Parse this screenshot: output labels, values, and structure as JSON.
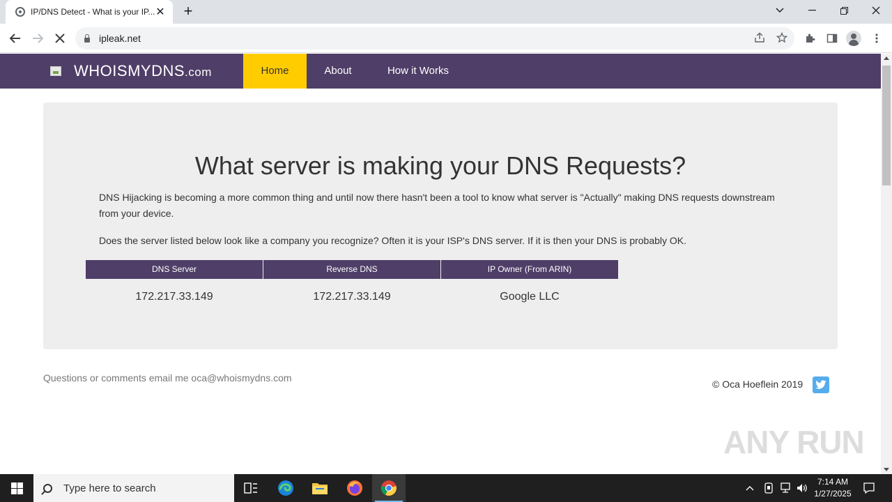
{
  "browser": {
    "tab_title": "IP/DNS Detect - What is your IP...",
    "url": "ipleak.net"
  },
  "site": {
    "brand_prefix": "WHOIS",
    "brand_main": "MYDNS",
    "brand_suffix": ".com",
    "nav": {
      "home": "Home",
      "about": "About",
      "how_it_works": "How it Works"
    },
    "heading": "What server is making your DNS Requests?",
    "para1": "DNS Hijacking is becoming a more common thing and until now there hasn't been a tool to know what server is \"Actually\" making DNS requests downstream from your device.",
    "para2": "Does the server listed below look like a company you recognize? Often it is your ISP's DNS server. If it is then your DNS is probably OK.",
    "table": {
      "headers": [
        "DNS Server",
        "Reverse DNS",
        "IP Owner (From ARIN)"
      ],
      "row": [
        "172.217.33.149",
        "172.217.33.149",
        "Google LLC"
      ]
    },
    "footer_contact": "Questions or comments email me oca@whoismydns.com",
    "footer_copyright": "© Oca Hoeflein 2019",
    "accent_color": "#4f3e68",
    "active_nav_color": "#ffcc00"
  },
  "watermark": "ANY RUN",
  "taskbar": {
    "search_placeholder": "Type here to search",
    "time": "7:14 AM",
    "date": "1/27/2025"
  }
}
